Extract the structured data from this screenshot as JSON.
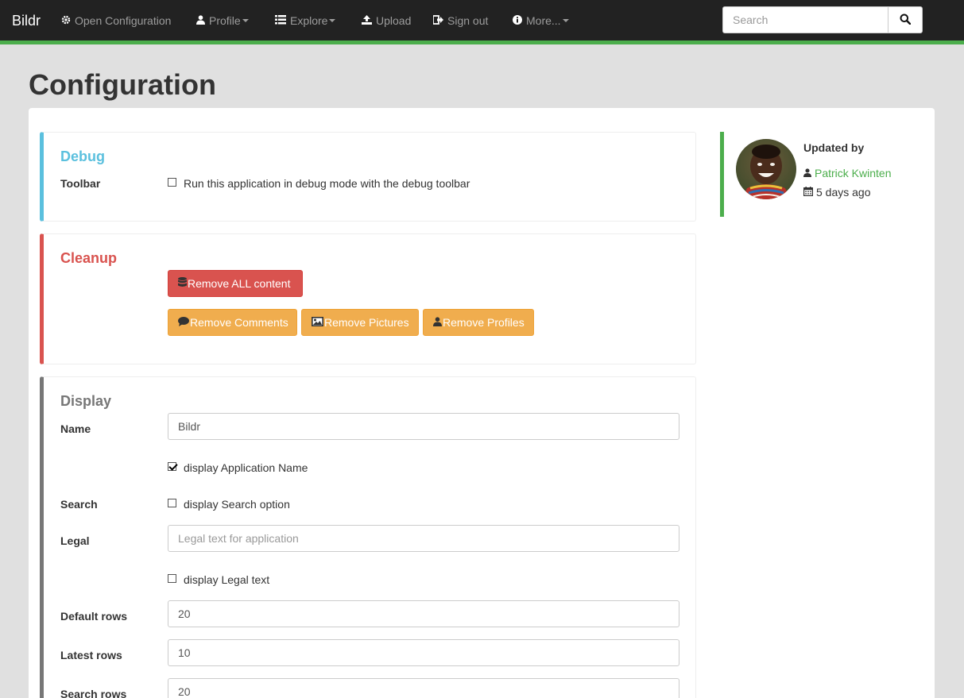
{
  "navbar": {
    "brand": "Bildr",
    "items": [
      {
        "label": "Open Configuration"
      },
      {
        "label": "Profile"
      },
      {
        "label": "Explore"
      },
      {
        "label": "Upload"
      },
      {
        "label": "Sign out"
      },
      {
        "label": "More..."
      }
    ],
    "search_placeholder": "Search"
  },
  "page": {
    "title": "Configuration"
  },
  "debug": {
    "title": "Debug",
    "toolbar_label": "Toolbar",
    "toolbar_checkbox": "Run this application in debug mode with the debug toolbar",
    "toolbar_checked": false
  },
  "cleanup": {
    "title": "Cleanup",
    "remove_all": "Remove ALL content",
    "remove_comments": "Remove Comments",
    "remove_pictures": "Remove Pictures",
    "remove_profiles": "Remove Profiles"
  },
  "display": {
    "title": "Display",
    "name_label": "Name",
    "name_value": "Bildr",
    "display_app_name": "display Application Name",
    "display_app_name_checked": true,
    "search_label": "Search",
    "display_search": "display Search option",
    "display_search_checked": false,
    "legal_label": "Legal",
    "legal_placeholder": "Legal text for application",
    "display_legal": "display Legal text",
    "display_legal_checked": false,
    "default_rows_label": "Default rows",
    "default_rows_value": "20",
    "latest_rows_label": "Latest rows",
    "latest_rows_value": "10",
    "search_rows_label": "Search rows",
    "search_rows_value": "20"
  },
  "sidebar": {
    "updated_by_label": "Updated by",
    "user_name": "Patrick Kwinten",
    "time_ago": "5 days ago"
  },
  "colors": {
    "navbar_bg": "#222222",
    "accent_green": "#4cae4c",
    "debug_accent": "#5bc0de",
    "danger": "#d9534f",
    "warning": "#f0ad4e",
    "display_accent": "#777777"
  },
  "icons": [
    "gear-icon",
    "user-icon",
    "list-icon",
    "upload-icon",
    "sign-out-icon",
    "info-icon",
    "search-icon",
    "database-icon",
    "comment-icon",
    "picture-icon",
    "calendar-icon"
  ]
}
